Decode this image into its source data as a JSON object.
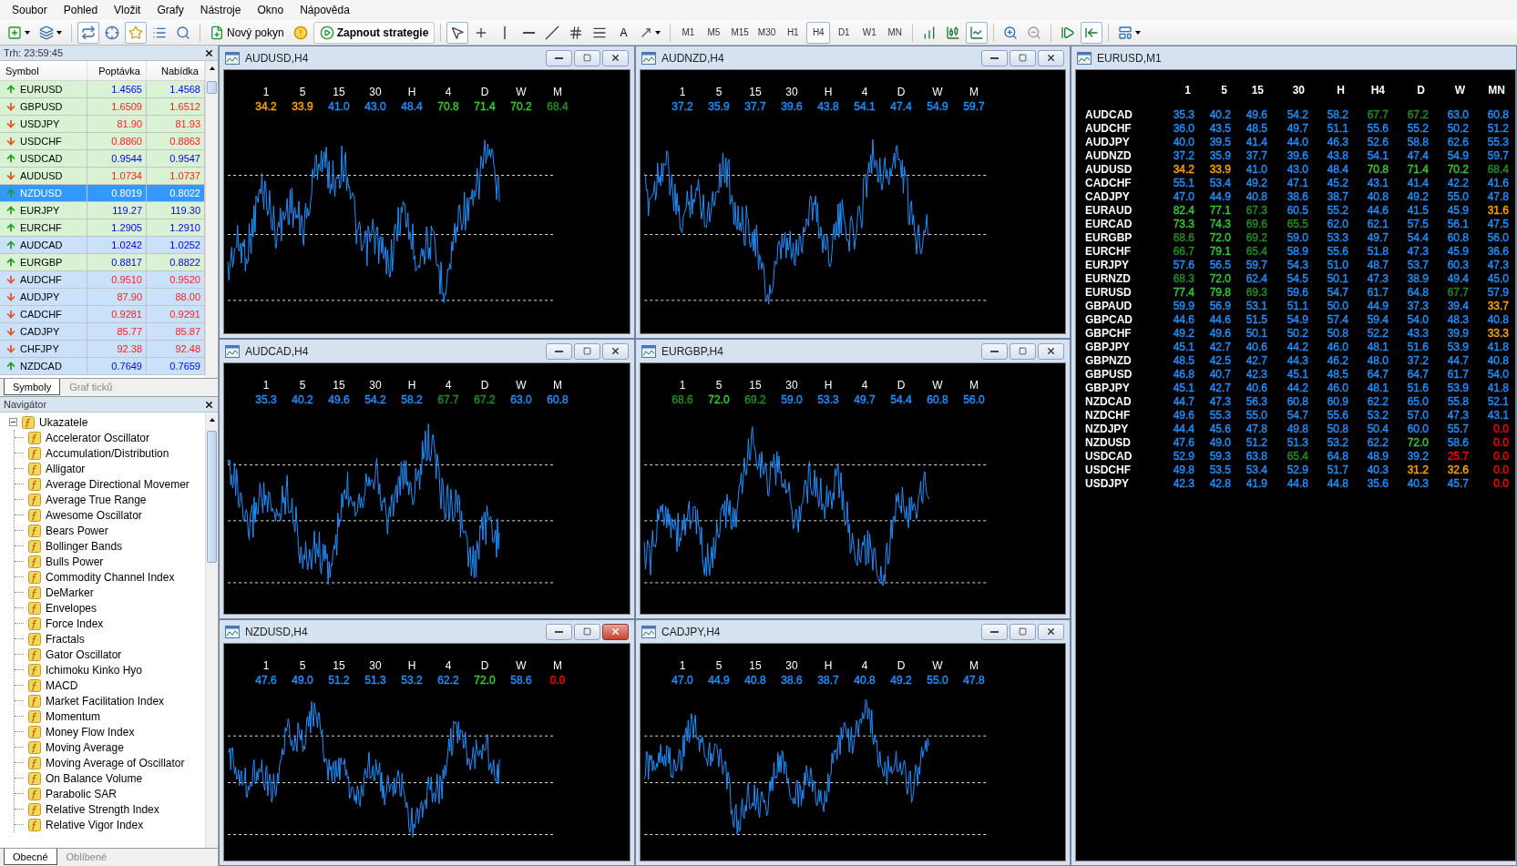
{
  "menu": [
    "Soubor",
    "Pohled",
    "Vložit",
    "Grafy",
    "Nástroje",
    "Okno",
    "Nápověda"
  ],
  "toolbar": {
    "toggles": [
      {
        "selected": true
      },
      {
        "selected": false
      },
      {
        "selected": true
      },
      {
        "selected": false
      },
      {
        "selected": false
      }
    ],
    "order_button": "Nový pokyn",
    "strategy_button": "Zapnout strategie",
    "tools": [
      {
        "selected": true
      },
      {
        "selected": false
      },
      {
        "selected": false
      },
      {
        "selected": false
      },
      {
        "selected": false
      },
      {
        "selected": false
      },
      {
        "selected": false
      }
    ],
    "text_tool": {
      "label": "A",
      "selected": false
    },
    "periods": [
      {
        "label": "M1",
        "selected": false
      },
      {
        "label": "M5",
        "selected": false
      },
      {
        "label": "M15",
        "selected": false
      },
      {
        "label": "M30",
        "selected": false
      },
      {
        "label": "H1",
        "selected": false
      },
      {
        "label": "H4",
        "selected": true
      },
      {
        "label": "D1",
        "selected": false
      },
      {
        "label": "W1",
        "selected": false
      },
      {
        "label": "MN",
        "selected": false
      }
    ],
    "chart_types": [
      {
        "selected": false
      },
      {
        "selected": false
      },
      {
        "selected": true
      }
    ],
    "scroll_modes": [
      {
        "selected": false
      },
      {
        "selected": true
      }
    ]
  },
  "market_watch": {
    "title": "Trh: 23:59:45",
    "columns": [
      "Symbol",
      "Poptávka",
      "Nabídka"
    ],
    "rows": [
      {
        "symbol": "EURUSD",
        "bid": "1.4565",
        "ask": "1.4568",
        "rising": true,
        "color": "#daf2d4",
        "selected": false
      },
      {
        "symbol": "GBPUSD",
        "bid": "1.6509",
        "ask": "1.6512",
        "rising": false,
        "color": "#daf2d4",
        "selected": false
      },
      {
        "symbol": "USDJPY",
        "bid": "81.90",
        "ask": "81.93",
        "rising": false,
        "color": "#daf2d4",
        "selected": false
      },
      {
        "symbol": "USDCHF",
        "bid": "0.8860",
        "ask": "0.8863",
        "rising": false,
        "color": "#daf2d4",
        "selected": false
      },
      {
        "symbol": "USDCAD",
        "bid": "0.9544",
        "ask": "0.9547",
        "rising": true,
        "color": "#daf2d4",
        "selected": false
      },
      {
        "symbol": "AUDUSD",
        "bid": "1.0734",
        "ask": "1.0737",
        "rising": false,
        "color": "#daf2d4",
        "selected": false
      },
      {
        "symbol": "NZDUSD",
        "bid": "0.8019",
        "ask": "0.8022",
        "rising": true,
        "selected": true
      },
      {
        "symbol": "EURJPY",
        "bid": "119.27",
        "ask": "119.30",
        "rising": true,
        "color": "#daf2d4",
        "selected": false
      },
      {
        "symbol": "EURCHF",
        "bid": "1.2905",
        "ask": "1.2910",
        "rising": true,
        "color": "#daf2d4",
        "selected": false
      },
      {
        "symbol": "AUDCAD",
        "bid": "1.0242",
        "ask": "1.0252",
        "rising": true,
        "color": "#c9e2fa",
        "selected": false
      },
      {
        "symbol": "EURGBP",
        "bid": "0.8817",
        "ask": "0.8822",
        "rising": true,
        "color": "#daf2d4",
        "selected": false
      },
      {
        "symbol": "AUDCHF",
        "bid": "0.9510",
        "ask": "0.9520",
        "rising": false,
        "color": "#c9e2fa",
        "selected": false
      },
      {
        "symbol": "AUDJPY",
        "bid": "87.90",
        "ask": "88.00",
        "rising": false,
        "color": "#c9e2fa",
        "selected": false
      },
      {
        "symbol": "CADCHF",
        "bid": "0.9281",
        "ask": "0.9291",
        "rising": false,
        "color": "#c9e2fa",
        "selected": false
      },
      {
        "symbol": "CADJPY",
        "bid": "85.77",
        "ask": "85.87",
        "rising": false,
        "color": "#c9e2fa",
        "selected": false
      },
      {
        "symbol": "CHFJPY",
        "bid": "92.38",
        "ask": "92.48",
        "rising": false,
        "color": "#c9e2fa",
        "selected": false
      },
      {
        "symbol": "NZDCAD",
        "bid": "0.7649",
        "ask": "0.7659",
        "rising": true,
        "color": "#c9e2fa",
        "selected": false
      }
    ],
    "tabs": [
      {
        "label": "Symboly",
        "selected": true
      },
      {
        "label": "Graf ticků",
        "selected": false
      }
    ]
  },
  "navigator": {
    "title": "Navigátor",
    "tree": [
      {
        "label": "Ukazatele",
        "expanded": true,
        "children": [
          {
            "label": "Accelerator Oscillator"
          },
          {
            "label": "Accumulation/Distribution"
          },
          {
            "label": "Alligator"
          },
          {
            "label": "Average Directional Movemer"
          },
          {
            "label": "Average True Range"
          },
          {
            "label": "Awesome Oscillator"
          },
          {
            "label": "Bears Power"
          },
          {
            "label": "Bollinger Bands"
          },
          {
            "label": "Bulls Power"
          },
          {
            "label": "Commodity Channel Index"
          },
          {
            "label": "DeMarker"
          },
          {
            "label": "Envelopes"
          },
          {
            "label": "Force Index"
          },
          {
            "label": "Fractals"
          },
          {
            "label": "Gator Oscillator"
          },
          {
            "label": "Ichimoku Kinko Hyo"
          },
          {
            "label": "MACD"
          },
          {
            "label": "Market Facilitation Index"
          },
          {
            "label": "Momentum"
          },
          {
            "label": "Money Flow Index"
          },
          {
            "label": "Moving Average"
          },
          {
            "label": "Moving Average of Oscillator"
          },
          {
            "label": "On Balance Volume"
          },
          {
            "label": "Parabolic SAR"
          },
          {
            "label": "Relative Strength Index"
          },
          {
            "label": "Relative Vigor Index"
          }
        ]
      }
    ],
    "tabs": [
      {
        "label": "Obecné",
        "selected": true
      },
      {
        "label": "Oblíbené",
        "selected": false
      }
    ]
  },
  "charts": [
    {
      "title": "AUDUSD,H4",
      "active": false,
      "headers": [
        "1",
        "5",
        "15",
        "30",
        "H",
        "4",
        "D",
        "W",
        "M"
      ],
      "values": [
        {
          "text": "34.2",
          "color": "#ffa500"
        },
        {
          "text": "33.9",
          "color": "#ffa500"
        },
        {
          "text": "41.0",
          "color": "#1e90ff"
        },
        {
          "text": "43.0",
          "color": "#1e90ff"
        },
        {
          "text": "48.4",
          "color": "#1e90ff"
        },
        {
          "text": "70.8",
          "color": "#32cd32"
        },
        {
          "text": "71.4",
          "color": "#32cd32"
        },
        {
          "text": "70.2",
          "color": "#32cd32"
        },
        {
          "text": "68.4",
          "color": "#1f8f1f"
        }
      ]
    },
    {
      "title": "AUDNZD,H4",
      "active": false,
      "headers": [
        "1",
        "5",
        "15",
        "30",
        "H",
        "4",
        "D",
        "W",
        "M"
      ],
      "values": [
        {
          "text": "37.2",
          "color": "#1e90ff"
        },
        {
          "text": "35.9",
          "color": "#1e90ff"
        },
        {
          "text": "37.7",
          "color": "#1e90ff"
        },
        {
          "text": "39.6",
          "color": "#1e90ff"
        },
        {
          "text": "43.8",
          "color": "#1e90ff"
        },
        {
          "text": "54.1",
          "color": "#1e90ff"
        },
        {
          "text": "47.4",
          "color": "#1e90ff"
        },
        {
          "text": "54.9",
          "color": "#1e90ff"
        },
        {
          "text": "59.7",
          "color": "#1e90ff"
        }
      ]
    },
    {
      "title": "AUDCAD,H4",
      "active": false,
      "headers": [
        "1",
        "5",
        "15",
        "30",
        "H",
        "4",
        "D",
        "W",
        "M"
      ],
      "values": [
        {
          "text": "35.3",
          "color": "#1e90ff"
        },
        {
          "text": "40.2",
          "color": "#1e90ff"
        },
        {
          "text": "49.6",
          "color": "#1e90ff"
        },
        {
          "text": "54.2",
          "color": "#1e90ff"
        },
        {
          "text": "58.2",
          "color": "#1e90ff"
        },
        {
          "text": "67.7",
          "color": "#1f8f1f"
        },
        {
          "text": "67.2",
          "color": "#1f8f1f"
        },
        {
          "text": "63.0",
          "color": "#1e90ff"
        },
        {
          "text": "60.8",
          "color": "#1e90ff"
        }
      ]
    },
    {
      "title": "EURGBP,H4",
      "active": false,
      "headers": [
        "1",
        "5",
        "15",
        "30",
        "H",
        "4",
        "D",
        "W",
        "M"
      ],
      "values": [
        {
          "text": "68.6",
          "color": "#1f8f1f"
        },
        {
          "text": "72.0",
          "color": "#32cd32"
        },
        {
          "text": "69.2",
          "color": "#1f8f1f"
        },
        {
          "text": "59.0",
          "color": "#1e90ff"
        },
        {
          "text": "53.3",
          "color": "#1e90ff"
        },
        {
          "text": "49.7",
          "color": "#1e90ff"
        },
        {
          "text": "54.4",
          "color": "#1e90ff"
        },
        {
          "text": "60.8",
          "color": "#1e90ff"
        },
        {
          "text": "56.0",
          "color": "#1e90ff"
        }
      ]
    },
    {
      "title": "NZDUSD,H4",
      "active": true,
      "headers": [
        "1",
        "5",
        "15",
        "30",
        "H",
        "4",
        "D",
        "W",
        "M"
      ],
      "values": [
        {
          "text": "47.6",
          "color": "#1e90ff"
        },
        {
          "text": "49.0",
          "color": "#1e90ff"
        },
        {
          "text": "51.2",
          "color": "#1e90ff"
        },
        {
          "text": "51.3",
          "color": "#1e90ff"
        },
        {
          "text": "53.2",
          "color": "#1e90ff"
        },
        {
          "text": "62.2",
          "color": "#1e90ff"
        },
        {
          "text": "72.0",
          "color": "#32cd32"
        },
        {
          "text": "58.6",
          "color": "#1e90ff"
        },
        {
          "text": "0.0",
          "color": "#ff0000"
        }
      ]
    },
    {
      "title": "CADJPY,H4",
      "active": false,
      "headers": [
        "1",
        "5",
        "15",
        "30",
        "H",
        "4",
        "D",
        "W",
        "M"
      ],
      "values": [
        {
          "text": "47.0",
          "color": "#1e90ff"
        },
        {
          "text": "44.9",
          "color": "#1e90ff"
        },
        {
          "text": "40.8",
          "color": "#1e90ff"
        },
        {
          "text": "38.6",
          "color": "#1e90ff"
        },
        {
          "text": "38.7",
          "color": "#1e90ff"
        },
        {
          "text": "40.8",
          "color": "#1e90ff"
        },
        {
          "text": "49.2",
          "color": "#1e90ff"
        },
        {
          "text": "55.0",
          "color": "#1e90ff"
        },
        {
          "text": "47.8",
          "color": "#1e90ff"
        }
      ]
    }
  ],
  "matrix": {
    "title": "EURUSD,M1",
    "headers": [
      "1",
      "5",
      "15",
      "30",
      "H",
      "H4",
      "D",
      "W",
      "MN"
    ],
    "rows": [
      {
        "symbol": "AUDCAD",
        "values": [
          {
            "text": "35.3",
            "color": "#1e90ff"
          },
          {
            "text": "40.2",
            "color": "#1e90ff"
          },
          {
            "text": "49.6",
            "color": "#1e90ff"
          },
          {
            "text": "54.2",
            "color": "#1e90ff"
          },
          {
            "text": "58.2",
            "color": "#1e90ff"
          },
          {
            "text": "67.7",
            "color": "#1f8f1f"
          },
          {
            "text": "67.2",
            "color": "#1f8f1f"
          },
          {
            "text": "63.0",
            "color": "#1e90ff"
          },
          {
            "text": "60.8",
            "color": "#1e90ff"
          }
        ]
      },
      {
        "symbol": "AUDCHF",
        "values": [
          {
            "text": "36.0",
            "color": "#1e90ff"
          },
          {
            "text": "43.5",
            "color": "#1e90ff"
          },
          {
            "text": "48.5",
            "color": "#1e90ff"
          },
          {
            "text": "49.7",
            "color": "#1e90ff"
          },
          {
            "text": "51.1",
            "color": "#1e90ff"
          },
          {
            "text": "55.6",
            "color": "#1e90ff"
          },
          {
            "text": "55.2",
            "color": "#1e90ff"
          },
          {
            "text": "50.2",
            "color": "#1e90ff"
          },
          {
            "text": "51.2",
            "color": "#1e90ff"
          }
        ]
      },
      {
        "symbol": "AUDJPY",
        "values": [
          {
            "text": "40.0",
            "color": "#1e90ff"
          },
          {
            "text": "39.5",
            "color": "#1e90ff"
          },
          {
            "text": "41.4",
            "color": "#1e90ff"
          },
          {
            "text": "44.0",
            "color": "#1e90ff"
          },
          {
            "text": "46.3",
            "color": "#1e90ff"
          },
          {
            "text": "52.6",
            "color": "#1e90ff"
          },
          {
            "text": "58.8",
            "color": "#1e90ff"
          },
          {
            "text": "62.6",
            "color": "#1e90ff"
          },
          {
            "text": "55.3",
            "color": "#1e90ff"
          }
        ]
      },
      {
        "symbol": "AUDNZD",
        "values": [
          {
            "text": "37.2",
            "color": "#1e90ff"
          },
          {
            "text": "35.9",
            "color": "#1e90ff"
          },
          {
            "text": "37.7",
            "color": "#1e90ff"
          },
          {
            "text": "39.6",
            "color": "#1e90ff"
          },
          {
            "text": "43.8",
            "color": "#1e90ff"
          },
          {
            "text": "54.1",
            "color": "#1e90ff"
          },
          {
            "text": "47.4",
            "color": "#1e90ff"
          },
          {
            "text": "54.9",
            "color": "#1e90ff"
          },
          {
            "text": "59.7",
            "color": "#1e90ff"
          }
        ]
      },
      {
        "symbol": "AUDUSD",
        "values": [
          {
            "text": "34.2",
            "color": "#ffa500"
          },
          {
            "text": "33.9",
            "color": "#ffa500"
          },
          {
            "text": "41.0",
            "color": "#1e90ff"
          },
          {
            "text": "43.0",
            "color": "#1e90ff"
          },
          {
            "text": "48.4",
            "color": "#1e90ff"
          },
          {
            "text": "70.8",
            "color": "#32cd32"
          },
          {
            "text": "71.4",
            "color": "#32cd32"
          },
          {
            "text": "70.2",
            "color": "#32cd32"
          },
          {
            "text": "68.4",
            "color": "#1f8f1f"
          }
        ]
      },
      {
        "symbol": "CADCHF",
        "values": [
          {
            "text": "55.1",
            "color": "#1e90ff"
          },
          {
            "text": "53.4",
            "color": "#1e90ff"
          },
          {
            "text": "49.2",
            "color": "#1e90ff"
          },
          {
            "text": "47.1",
            "color": "#1e90ff"
          },
          {
            "text": "45.2",
            "color": "#1e90ff"
          },
          {
            "text": "43.1",
            "color": "#1e90ff"
          },
          {
            "text": "41.4",
            "color": "#1e90ff"
          },
          {
            "text": "42.2",
            "color": "#1e90ff"
          },
          {
            "text": "41.6",
            "color": "#1e90ff"
          }
        ]
      },
      {
        "symbol": "CADJPY",
        "values": [
          {
            "text": "47.0",
            "color": "#1e90ff"
          },
          {
            "text": "44.9",
            "color": "#1e90ff"
          },
          {
            "text": "40.8",
            "color": "#1e90ff"
          },
          {
            "text": "38.6",
            "color": "#1e90ff"
          },
          {
            "text": "38.7",
            "color": "#1e90ff"
          },
          {
            "text": "40.8",
            "color": "#1e90ff"
          },
          {
            "text": "49.2",
            "color": "#1e90ff"
          },
          {
            "text": "55.0",
            "color": "#1e90ff"
          },
          {
            "text": "47.8",
            "color": "#1e90ff"
          }
        ]
      },
      {
        "symbol": "EURAUD",
        "values": [
          {
            "text": "82.4",
            "color": "#32cd32"
          },
          {
            "text": "77.1",
            "color": "#32cd32"
          },
          {
            "text": "67.3",
            "color": "#1f8f1f"
          },
          {
            "text": "60.5",
            "color": "#1e90ff"
          },
          {
            "text": "55.2",
            "color": "#1e90ff"
          },
          {
            "text": "44.6",
            "color": "#1e90ff"
          },
          {
            "text": "41.5",
            "color": "#1e90ff"
          },
          {
            "text": "45.9",
            "color": "#1e90ff"
          },
          {
            "text": "31.6",
            "color": "#ffa500"
          }
        ]
      },
      {
        "symbol": "EURCAD",
        "values": [
          {
            "text": "73.3",
            "color": "#32cd32"
          },
          {
            "text": "74.3",
            "color": "#32cd32"
          },
          {
            "text": "69.6",
            "color": "#1f8f1f"
          },
          {
            "text": "65.5",
            "color": "#1f8f1f"
          },
          {
            "text": "62.0",
            "color": "#1e90ff"
          },
          {
            "text": "62.1",
            "color": "#1e90ff"
          },
          {
            "text": "57.5",
            "color": "#1e90ff"
          },
          {
            "text": "56.1",
            "color": "#1e90ff"
          },
          {
            "text": "47.5",
            "color": "#1e90ff"
          }
        ]
      },
      {
        "symbol": "EURGBP",
        "values": [
          {
            "text": "68.6",
            "color": "#1f8f1f"
          },
          {
            "text": "72.0",
            "color": "#32cd32"
          },
          {
            "text": "69.2",
            "color": "#1f8f1f"
          },
          {
            "text": "59.0",
            "color": "#1e90ff"
          },
          {
            "text": "53.3",
            "color": "#1e90ff"
          },
          {
            "text": "49.7",
            "color": "#1e90ff"
          },
          {
            "text": "54.4",
            "color": "#1e90ff"
          },
          {
            "text": "60.8",
            "color": "#1e90ff"
          },
          {
            "text": "56.0",
            "color": "#1e90ff"
          }
        ]
      },
      {
        "symbol": "EURCHF",
        "values": [
          {
            "text": "66.7",
            "color": "#1f8f1f"
          },
          {
            "text": "79.1",
            "color": "#32cd32"
          },
          {
            "text": "65.4",
            "color": "#1f8f1f"
          },
          {
            "text": "58.9",
            "color": "#1e90ff"
          },
          {
            "text": "55.6",
            "color": "#1e90ff"
          },
          {
            "text": "51.8",
            "color": "#1e90ff"
          },
          {
            "text": "47.3",
            "color": "#1e90ff"
          },
          {
            "text": "45.9",
            "color": "#1e90ff"
          },
          {
            "text": "36.6",
            "color": "#1e90ff"
          }
        ]
      },
      {
        "symbol": "EURJPY",
        "values": [
          {
            "text": "57.6",
            "color": "#1e90ff"
          },
          {
            "text": "56.5",
            "color": "#1e90ff"
          },
          {
            "text": "59.7",
            "color": "#1e90ff"
          },
          {
            "text": "54.3",
            "color": "#1e90ff"
          },
          {
            "text": "51.0",
            "color": "#1e90ff"
          },
          {
            "text": "48.7",
            "color": "#1e90ff"
          },
          {
            "text": "53.7",
            "color": "#1e90ff"
          },
          {
            "text": "60.3",
            "color": "#1e90ff"
          },
          {
            "text": "47.3",
            "color": "#1e90ff"
          }
        ]
      },
      {
        "symbol": "EURNZD",
        "values": [
          {
            "text": "68.3",
            "color": "#1f8f1f"
          },
          {
            "text": "72.0",
            "color": "#32cd32"
          },
          {
            "text": "62.4",
            "color": "#1e90ff"
          },
          {
            "text": "54.5",
            "color": "#1e90ff"
          },
          {
            "text": "50.1",
            "color": "#1e90ff"
          },
          {
            "text": "47.3",
            "color": "#1e90ff"
          },
          {
            "text": "38.9",
            "color": "#1e90ff"
          },
          {
            "text": "49.4",
            "color": "#1e90ff"
          },
          {
            "text": "45.0",
            "color": "#1e90ff"
          }
        ]
      },
      {
        "symbol": "EURUSD",
        "values": [
          {
            "text": "77.4",
            "color": "#32cd32"
          },
          {
            "text": "79.8",
            "color": "#32cd32"
          },
          {
            "text": "69.3",
            "color": "#1f8f1f"
          },
          {
            "text": "59.6",
            "color": "#1e90ff"
          },
          {
            "text": "54.7",
            "color": "#1e90ff"
          },
          {
            "text": "61.7",
            "color": "#1e90ff"
          },
          {
            "text": "64.8",
            "color": "#1e90ff"
          },
          {
            "text": "67.7",
            "color": "#1f8f1f"
          },
          {
            "text": "57.9",
            "color": "#1e90ff"
          }
        ]
      },
      {
        "symbol": "GBPAUD",
        "values": [
          {
            "text": "59.9",
            "color": "#1e90ff"
          },
          {
            "text": "56.9",
            "color": "#1e90ff"
          },
          {
            "text": "53.1",
            "color": "#1e90ff"
          },
          {
            "text": "51.1",
            "color": "#1e90ff"
          },
          {
            "text": "50.0",
            "color": "#1e90ff"
          },
          {
            "text": "44.9",
            "color": "#1e90ff"
          },
          {
            "text": "37.3",
            "color": "#1e90ff"
          },
          {
            "text": "39.4",
            "color": "#1e90ff"
          },
          {
            "text": "33.7",
            "color": "#ffa500"
          }
        ]
      },
      {
        "symbol": "GBPCAD",
        "values": [
          {
            "text": "44.6",
            "color": "#1e90ff"
          },
          {
            "text": "44.6",
            "color": "#1e90ff"
          },
          {
            "text": "51.5",
            "color": "#1e90ff"
          },
          {
            "text": "54.9",
            "color": "#1e90ff"
          },
          {
            "text": "57.4",
            "color": "#1e90ff"
          },
          {
            "text": "59.4",
            "color": "#1e90ff"
          },
          {
            "text": "54.0",
            "color": "#1e90ff"
          },
          {
            "text": "48.3",
            "color": "#1e90ff"
          },
          {
            "text": "40.8",
            "color": "#1e90ff"
          }
        ]
      },
      {
        "symbol": "GBPCHF",
        "values": [
          {
            "text": "49.2",
            "color": "#1e90ff"
          },
          {
            "text": "49.6",
            "color": "#1e90ff"
          },
          {
            "text": "50.1",
            "color": "#1e90ff"
          },
          {
            "text": "50.2",
            "color": "#1e90ff"
          },
          {
            "text": "50.8",
            "color": "#1e90ff"
          },
          {
            "text": "52.2",
            "color": "#1e90ff"
          },
          {
            "text": "43.3",
            "color": "#1e90ff"
          },
          {
            "text": "39.9",
            "color": "#1e90ff"
          },
          {
            "text": "33.3",
            "color": "#ffa500"
          }
        ]
      },
      {
        "symbol": "GBPJPY",
        "values": [
          {
            "text": "45.1",
            "color": "#1e90ff"
          },
          {
            "text": "42.7",
            "color": "#1e90ff"
          },
          {
            "text": "40.6",
            "color": "#1e90ff"
          },
          {
            "text": "44.2",
            "color": "#1e90ff"
          },
          {
            "text": "46.0",
            "color": "#1e90ff"
          },
          {
            "text": "48.1",
            "color": "#1e90ff"
          },
          {
            "text": "51.6",
            "color": "#1e90ff"
          },
          {
            "text": "53.9",
            "color": "#1e90ff"
          },
          {
            "text": "41.8",
            "color": "#1e90ff"
          }
        ]
      },
      {
        "symbol": "GBPNZD",
        "values": [
          {
            "text": "48.5",
            "color": "#1e90ff"
          },
          {
            "text": "42.5",
            "color": "#1e90ff"
          },
          {
            "text": "42.7",
            "color": "#1e90ff"
          },
          {
            "text": "44.3",
            "color": "#1e90ff"
          },
          {
            "text": "46.2",
            "color": "#1e90ff"
          },
          {
            "text": "48.0",
            "color": "#1e90ff"
          },
          {
            "text": "37.2",
            "color": "#1e90ff"
          },
          {
            "text": "44.7",
            "color": "#1e90ff"
          },
          {
            "text": "40.8",
            "color": "#1e90ff"
          }
        ]
      },
      {
        "symbol": "GBPUSD",
        "values": [
          {
            "text": "46.8",
            "color": "#1e90ff"
          },
          {
            "text": "40.7",
            "color": "#1e90ff"
          },
          {
            "text": "42.3",
            "color": "#1e90ff"
          },
          {
            "text": "45.1",
            "color": "#1e90ff"
          },
          {
            "text": "48.5",
            "color": "#1e90ff"
          },
          {
            "text": "64.7",
            "color": "#1e90ff"
          },
          {
            "text": "64.7",
            "color": "#1e90ff"
          },
          {
            "text": "61.7",
            "color": "#1e90ff"
          },
          {
            "text": "54.0",
            "color": "#1e90ff"
          }
        ]
      },
      {
        "symbol": "GBPJPY",
        "values": [
          {
            "text": "45.1",
            "color": "#1e90ff"
          },
          {
            "text": "42.7",
            "color": "#1e90ff"
          },
          {
            "text": "40.6",
            "color": "#1e90ff"
          },
          {
            "text": "44.2",
            "color": "#1e90ff"
          },
          {
            "text": "46.0",
            "color": "#1e90ff"
          },
          {
            "text": "48.1",
            "color": "#1e90ff"
          },
          {
            "text": "51.6",
            "color": "#1e90ff"
          },
          {
            "text": "53.9",
            "color": "#1e90ff"
          },
          {
            "text": "41.8",
            "color": "#1e90ff"
          }
        ]
      },
      {
        "symbol": "NZDCAD",
        "values": [
          {
            "text": "44.7",
            "color": "#1e90ff"
          },
          {
            "text": "47.3",
            "color": "#1e90ff"
          },
          {
            "text": "56.3",
            "color": "#1e90ff"
          },
          {
            "text": "60.8",
            "color": "#1e90ff"
          },
          {
            "text": "60.9",
            "color": "#1e90ff"
          },
          {
            "text": "62.2",
            "color": "#1e90ff"
          },
          {
            "text": "65.0",
            "color": "#1e90ff"
          },
          {
            "text": "55.8",
            "color": "#1e90ff"
          },
          {
            "text": "52.1",
            "color": "#1e90ff"
          }
        ]
      },
      {
        "symbol": "NZDCHF",
        "values": [
          {
            "text": "49.6",
            "color": "#1e90ff"
          },
          {
            "text": "55.3",
            "color": "#1e90ff"
          },
          {
            "text": "55.0",
            "color": "#1e90ff"
          },
          {
            "text": "54.7",
            "color": "#1e90ff"
          },
          {
            "text": "55.6",
            "color": "#1e90ff"
          },
          {
            "text": "53.2",
            "color": "#1e90ff"
          },
          {
            "text": "57.0",
            "color": "#1e90ff"
          },
          {
            "text": "47.3",
            "color": "#1e90ff"
          },
          {
            "text": "43.1",
            "color": "#1e90ff"
          }
        ]
      },
      {
        "symbol": "NZDJPY",
        "values": [
          {
            "text": "44.4",
            "color": "#1e90ff"
          },
          {
            "text": "45.6",
            "color": "#1e90ff"
          },
          {
            "text": "47.8",
            "color": "#1e90ff"
          },
          {
            "text": "49.8",
            "color": "#1e90ff"
          },
          {
            "text": "50.8",
            "color": "#1e90ff"
          },
          {
            "text": "50.4",
            "color": "#1e90ff"
          },
          {
            "text": "60.0",
            "color": "#1e90ff"
          },
          {
            "text": "55.7",
            "color": "#1e90ff"
          },
          {
            "text": "0.0",
            "color": "#ff0000"
          }
        ]
      },
      {
        "symbol": "NZDUSD",
        "values": [
          {
            "text": "47.6",
            "color": "#1e90ff"
          },
          {
            "text": "49.0",
            "color": "#1e90ff"
          },
          {
            "text": "51.2",
            "color": "#1e90ff"
          },
          {
            "text": "51.3",
            "color": "#1e90ff"
          },
          {
            "text": "53.2",
            "color": "#1e90ff"
          },
          {
            "text": "62.2",
            "color": "#1e90ff"
          },
          {
            "text": "72.0",
            "color": "#32cd32"
          },
          {
            "text": "58.6",
            "color": "#1e90ff"
          },
          {
            "text": "0.0",
            "color": "#ff0000"
          }
        ]
      },
      {
        "symbol": "USDCAD",
        "values": [
          {
            "text": "52.9",
            "color": "#1e90ff"
          },
          {
            "text": "59.3",
            "color": "#1e90ff"
          },
          {
            "text": "63.8",
            "color": "#1e90ff"
          },
          {
            "text": "65.4",
            "color": "#1f8f1f"
          },
          {
            "text": "64.8",
            "color": "#1e90ff"
          },
          {
            "text": "48.9",
            "color": "#1e90ff"
          },
          {
            "text": "39.2",
            "color": "#1e90ff"
          },
          {
            "text": "25.7",
            "color": "#ff0000"
          },
          {
            "text": "0.0",
            "color": "#ff0000"
          }
        ]
      },
      {
        "symbol": "USDCHF",
        "values": [
          {
            "text": "49.8",
            "color": "#1e90ff"
          },
          {
            "text": "53.5",
            "color": "#1e90ff"
          },
          {
            "text": "53.4",
            "color": "#1e90ff"
          },
          {
            "text": "52.9",
            "color": "#1e90ff"
          },
          {
            "text": "51.7",
            "color": "#1e90ff"
          },
          {
            "text": "40.3",
            "color": "#1e90ff"
          },
          {
            "text": "31.2",
            "color": "#ffa500"
          },
          {
            "text": "32.6",
            "color": "#ffa500"
          },
          {
            "text": "0.0",
            "color": "#ff0000"
          }
        ]
      },
      {
        "symbol": "USDJPY",
        "values": [
          {
            "text": "42.3",
            "color": "#1e90ff"
          },
          {
            "text": "42.8",
            "color": "#1e90ff"
          },
          {
            "text": "41.9",
            "color": "#1e90ff"
          },
          {
            "text": "44.8",
            "color": "#1e90ff"
          },
          {
            "text": "44.8",
            "color": "#1e90ff"
          },
          {
            "text": "35.6",
            "color": "#1e90ff"
          },
          {
            "text": "40.3",
            "color": "#1e90ff"
          },
          {
            "text": "45.7",
            "color": "#1e90ff"
          },
          {
            "text": "0.0",
            "color": "#ff0000"
          }
        ]
      }
    ]
  }
}
